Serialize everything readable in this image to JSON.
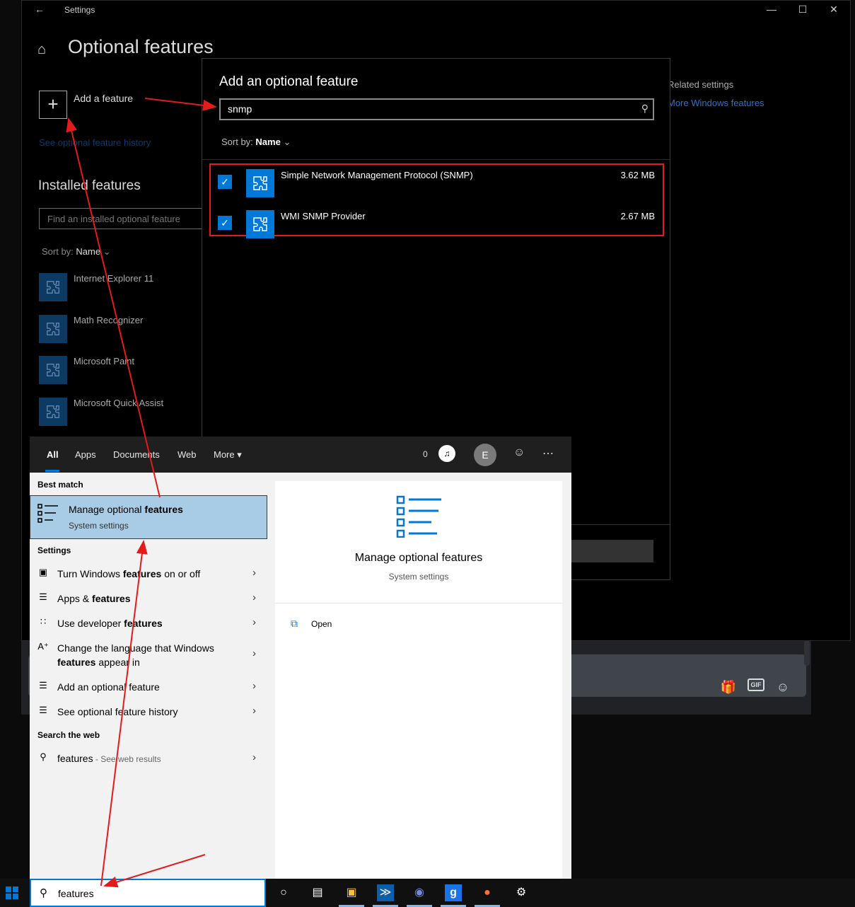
{
  "settings_window": {
    "title": "Settings",
    "page_title": "Optional features",
    "add_feature_label": "Add a feature",
    "history_link": "See optional feature history",
    "installed_title": "Installed features",
    "find_placeholder": "Find an installed optional feature",
    "sort_prefix": "Sort by: ",
    "sort_value": "Name",
    "installed_items": [
      "Internet Explorer 11",
      "Math Recognizer",
      "Microsoft Paint",
      "Microsoft Quick Assist"
    ],
    "related_title": "Related settings",
    "related_link": "More Windows features"
  },
  "dialog": {
    "title": "Add an optional feature",
    "search_value": "snmp",
    "sort_prefix": "Sort by: ",
    "sort_value": "Name",
    "features": [
      {
        "name": "Simple Network Management Protocol (SNMP)",
        "size": "3.62 MB",
        "checked": true
      },
      {
        "name": "WMI SNMP Provider",
        "size": "2.67 MB",
        "checked": true
      }
    ]
  },
  "search_panel": {
    "tabs": [
      "All",
      "Apps",
      "Documents",
      "Web",
      "More"
    ],
    "points": "0",
    "avatar_letter": "E",
    "best_match_head": "Best match",
    "best_match_title_pre": "Manage optional ",
    "best_match_title_bold": "features",
    "best_match_sub": "System settings",
    "settings_head": "Settings",
    "settings_items": [
      {
        "pre": "Turn Windows ",
        "bold": "features",
        "post": " on or off"
      },
      {
        "pre": "Apps & ",
        "bold": "features",
        "post": ""
      },
      {
        "pre": "Use developer ",
        "bold": "features",
        "post": ""
      },
      {
        "pre": "Change the language that Windows ",
        "bold": "features",
        "post": " appear in"
      },
      {
        "pre": "Add an optional feature",
        "bold": "",
        "post": ""
      },
      {
        "pre": "See optional feature history",
        "bold": "",
        "post": ""
      }
    ],
    "web_head": "Search the web",
    "web_query": "features",
    "web_sub": " - See web results",
    "preview_title": "Manage optional features",
    "preview_sub": "System settings",
    "open_label": "Open"
  },
  "taskbar": {
    "search_value": "features"
  },
  "colors": {
    "accent": "#0078d7",
    "annotation": "#e21b1b",
    "best_match_bg": "#a9cce6"
  }
}
